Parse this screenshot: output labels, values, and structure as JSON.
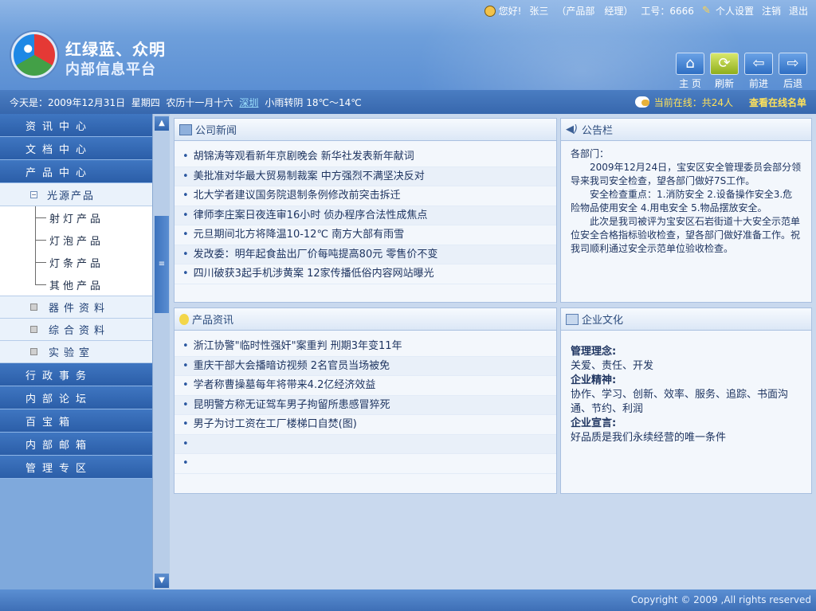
{
  "header": {
    "greeting": "您好!",
    "user_name": "张三",
    "department": "（产品部　经理）",
    "employee_id": "工号：6666",
    "settings_label": "个人设置",
    "logout_label": "注销",
    "exit_label": "退出",
    "brand_line1": "红绿蓝、众明",
    "brand_line2": "内部信息平台",
    "nav_buttons": [
      "主 页",
      "刷新",
      "前进",
      "后退"
    ]
  },
  "infobar": {
    "date": "今天是：2009年12月31日",
    "weekday": "星期四",
    "lunar": "农历十一月十六",
    "city": "深圳",
    "weather": "小雨转阴 18℃～14℃",
    "online_count": "当前在线：共24人",
    "view_online": "查看在线名单"
  },
  "sidebar": {
    "top_items": [
      "资讯中心",
      "文档中心",
      "产品中心"
    ],
    "sub_header": "光源产品",
    "tree_items": [
      "射灯产品",
      "灯泡产品",
      "灯条产品",
      "其他产品"
    ],
    "sub_items": [
      "器件资料",
      "综合资料",
      "实验室"
    ],
    "bottom_items": [
      "行政事务",
      "内部论坛",
      "百宝箱",
      "内部邮箱",
      "管理专区"
    ]
  },
  "panels": {
    "news_title": "公司新闻",
    "news_items": [
      "胡锦涛等观看新年京剧晚会 新华社发表新年献词",
      "美批准对华最大贸易制裁案 中方强烈不满坚决反对",
      "北大学者建议国务院退制条例修改前突击拆迁",
      "律师李庄案日夜连审16小时 侦办程序合法性成焦点",
      "元旦期间北方将降温10-12℃ 南方大部有雨雪",
      "发改委：明年起食盐出厂价每吨提高80元 零售价不变",
      "四川破获3起手机涉黄案 12家传播低俗内容网站曝光"
    ],
    "notice_title": "公告栏",
    "notice_to": "各部门：",
    "notice_paragraphs": [
      "2009年12月24日，宝安区安全管理委员会部分领导来我司安全检查，望各部门做好7S工作。",
      "安全检查重点：1.消防安全 2.设备操作安全3.危险物品使用安全 4.用电安全 5.物品摆放安全。",
      "此次是我司被评为宝安区石岩街道十大安全示范单位安全合格指标验收检查，望各部门做好准备工作。祝我司顺利通过安全示范单位验收检查。"
    ],
    "product_title": "产品资讯",
    "product_items": [
      "浙江协警\"临时性强奸\"案重判 刑期3年变11年",
      "重庆干部大会播暗访视频 2名官员当场被免",
      "学者称曹操墓每年将带来4.2亿经济效益",
      "昆明警方称无证驾车男子拘留所患感冒猝死",
      "男子为讨工资在工厂楼梯口自焚(图)"
    ],
    "culture_title": "企业文化",
    "culture": {
      "concept_label": "管理理念:",
      "concept": "关爱、责任、开发",
      "spirit_label": "企业精神:",
      "spirit": "协作、学习、创新、效率、服务、追踪、书面沟通、节约、利润",
      "slogan_label": "企业宣言:",
      "slogan": "好品质是我们永续经营的唯一条件"
    }
  },
  "footer": {
    "copyright": "Copyright © 2009 ,All rights reserved"
  },
  "colors": {
    "header_blue": "#6e9fdb",
    "accent_yellow": "#ffe25a",
    "menu_blue": "#2b5ea8"
  }
}
